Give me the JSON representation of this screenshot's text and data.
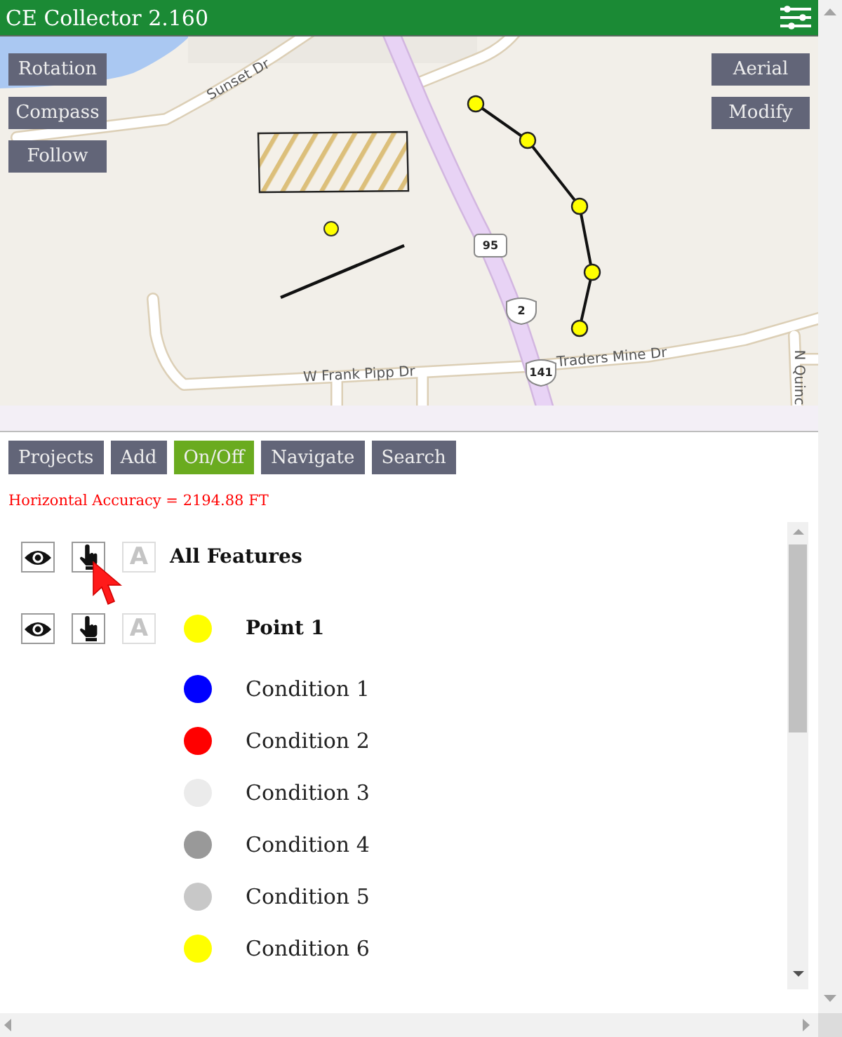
{
  "app_bar": {
    "title": "CE Collector 2.160"
  },
  "map": {
    "left_buttons": [
      "Rotation",
      "Compass",
      "Follow"
    ],
    "right_buttons": [
      "Aerial",
      "Modify"
    ],
    "road_labels": [
      "Sunset Dr",
      "W Frank Pipp Dr",
      "Traders Mine Dr",
      "N Quinc"
    ],
    "route_shields": [
      "95",
      "2",
      "141"
    ]
  },
  "toolbar": [
    {
      "label": "Projects",
      "selected": false
    },
    {
      "label": "Add",
      "selected": false
    },
    {
      "label": "On/Off",
      "selected": true
    },
    {
      "label": "Navigate",
      "selected": false
    },
    {
      "label": "Search",
      "selected": false
    }
  ],
  "accuracy": "Horizontal Accuracy = 2194.88 FT",
  "layers": {
    "all": {
      "label": "All Features",
      "visible": true,
      "selectable": true,
      "labels": false,
      "labels_glyph": "A"
    },
    "items": [
      {
        "label": "Point 1",
        "color": "#ffff00",
        "visible": true,
        "selectable": true,
        "labels": false,
        "labels_glyph": "A",
        "classes": [
          {
            "label": "Condition 1",
            "color": "#0000ff"
          },
          {
            "label": "Condition 2",
            "color": "#ff0000"
          },
          {
            "label": "Condition 3",
            "color": "#ebebeb"
          },
          {
            "label": "Condition 4",
            "color": "#999999"
          },
          {
            "label": "Condition 5",
            "color": "#c8c8c8"
          },
          {
            "label": "Condition 6",
            "color": "#ffff00"
          }
        ]
      }
    ]
  }
}
